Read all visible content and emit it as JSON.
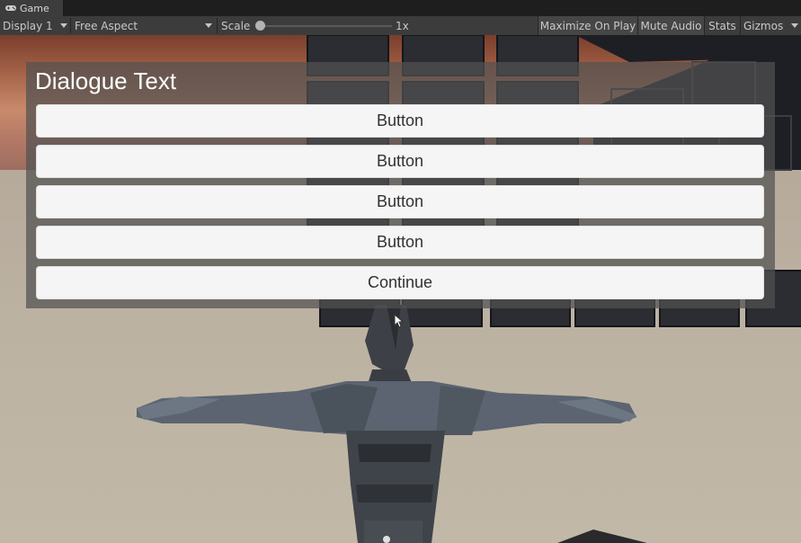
{
  "window": {
    "tab_title": "Game",
    "tab_icon": "gamepad-icon"
  },
  "toolbar": {
    "display": "Display 1",
    "aspect": "Free Aspect",
    "scale_label": "Scale",
    "scale_value": "1x",
    "maximize_on_play": "Maximize On Play",
    "mute_audio": "Mute Audio",
    "stats": "Stats",
    "gizmos": "Gizmos"
  },
  "dialogue": {
    "title": "Dialogue Text",
    "buttons": [
      "Button",
      "Button",
      "Button",
      "Button"
    ],
    "continue_label": "Continue"
  },
  "colors": {
    "editor_bg": "#3c3c3c",
    "panel_bg": "rgba(82,82,82,0.72)",
    "button_bg": "#f5f5f5",
    "button_text": "#323232"
  }
}
